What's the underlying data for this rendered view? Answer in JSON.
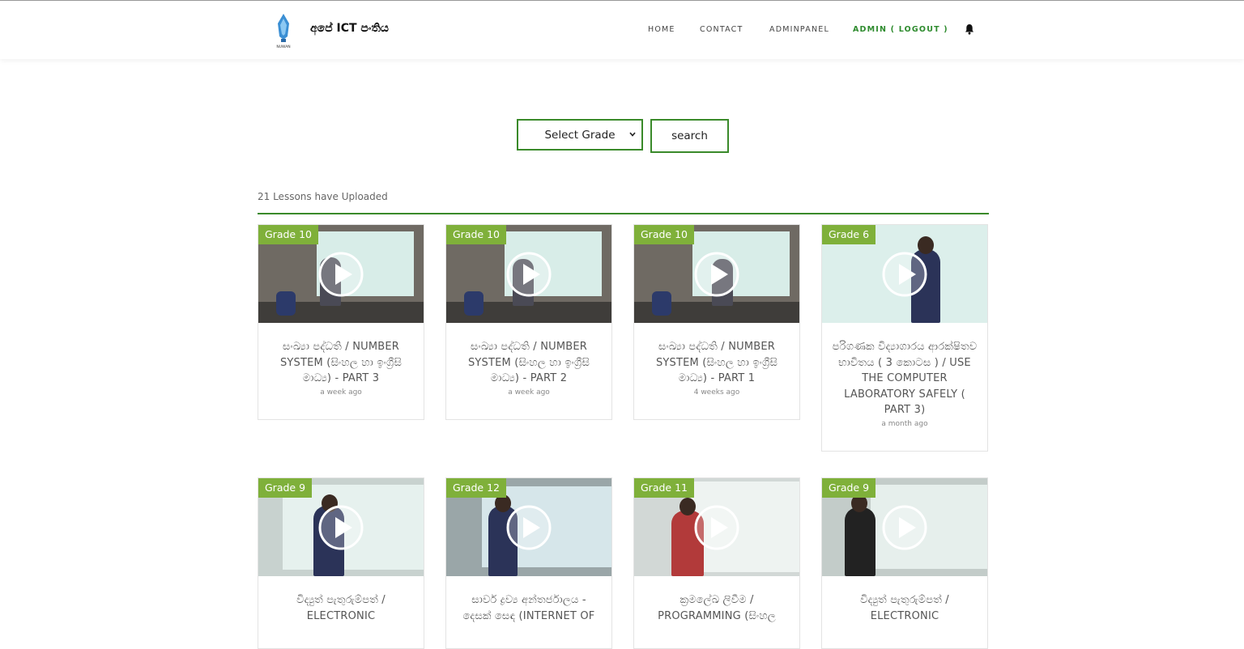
{
  "brand": {
    "name": "අපේ ICT පංතිය",
    "logo_caption": "NUWAN"
  },
  "nav": {
    "items": [
      {
        "label": "HOME"
      },
      {
        "label": "CONTACT"
      },
      {
        "label": "ADMINPANEL"
      },
      {
        "label": "ADMIN ( LOGOUT )"
      }
    ],
    "bell_icon": "bell-icon"
  },
  "filter": {
    "select_value": "Select Grade",
    "search_label": "search"
  },
  "summary": {
    "count_text": "21 Lessons have Uploaded"
  },
  "colors": {
    "accent": "#3a8a2a",
    "grade_badge": "#7fb03a"
  },
  "lessons": [
    {
      "grade": "Grade 10",
      "title": "සංඛ්‍යා පද්ධති / NUMBER SYSTEM (සිංහල හා ඉංග්‍රීසි මාධ්‍ය) - PART 3",
      "ago": "a week ago"
    },
    {
      "grade": "Grade 10",
      "title": "සංඛ්‍යා පද්ධති / NUMBER SYSTEM (සිංහල හා ඉංග්‍රීසි මාධ්‍ය) - PART 2",
      "ago": "a week ago"
    },
    {
      "grade": "Grade 10",
      "title": "සංඛ්‍යා පද්ධති / NUMBER SYSTEM (සිංහල හා ඉංග්‍රීසි මාධ්‍ය) - PART 1",
      "ago": "4 weeks ago"
    },
    {
      "grade": "Grade 6",
      "title": "පරිගණක විද්‍යාගාරය ආරක්ෂිතව භාවිතය ( 3 කොටස ) / USE THE COMPUTER LABORATORY SAFELY ( PART 3)",
      "ago": "a month ago"
    },
    {
      "grade": "Grade 9",
      "title": "විද්‍යුත් පැතුරුම්පත් / ELECTRONIC",
      "ago": ""
    },
    {
      "grade": "Grade 12",
      "title": "සාර්ව ද්‍රව්‍ය අන්තර්ජාලය - දෙසක් සෙඳ (INTERNET OF",
      "ago": ""
    },
    {
      "grade": "Grade 11",
      "title": "ක්‍රමලේඛ ලිවීම / PROGRAMMING (සිංහල",
      "ago": ""
    },
    {
      "grade": "Grade 9",
      "title": "විද්‍යුත් පැතුරුම්පත් / ELECTRONIC",
      "ago": ""
    }
  ]
}
